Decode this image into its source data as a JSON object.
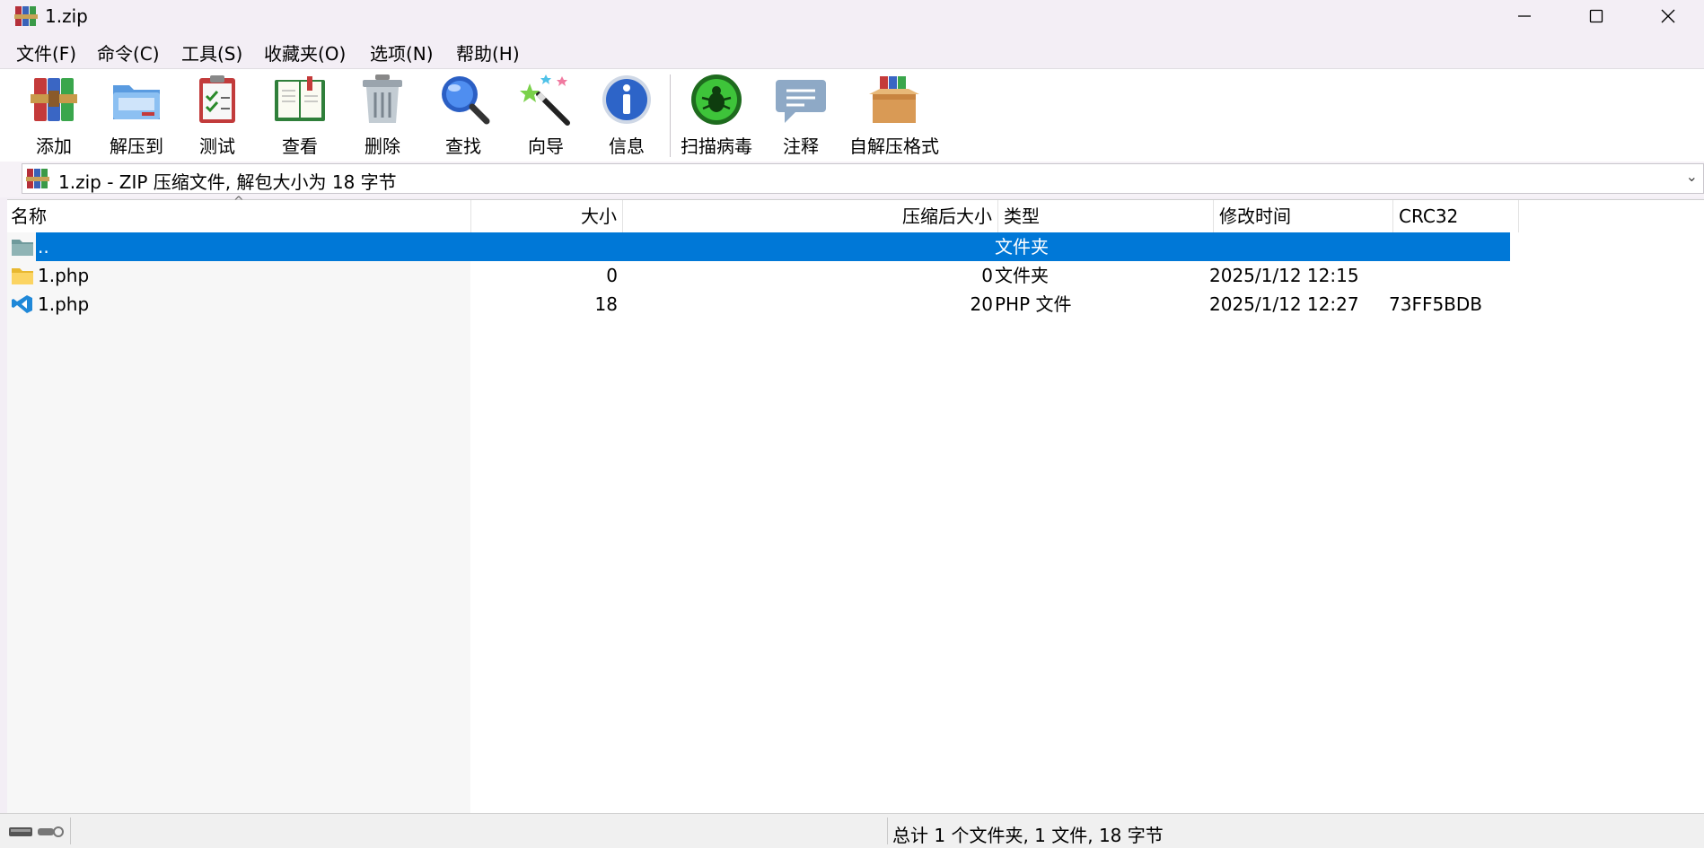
{
  "window": {
    "title": "1.zip",
    "controls": [
      "minimize",
      "maximize",
      "close"
    ]
  },
  "menu": [
    "文件(F)",
    "命令(C)",
    "工具(S)",
    "收藏夹(O)",
    "选项(N)",
    "帮助(H)"
  ],
  "toolbar": {
    "buttons": [
      {
        "label": "添加",
        "icon": "add-archive-icon"
      },
      {
        "label": "解压到",
        "icon": "extract-folder-icon"
      },
      {
        "label": "测试",
        "icon": "test-clipboard-icon"
      },
      {
        "label": "查看",
        "icon": "view-book-icon"
      },
      {
        "label": "删除",
        "icon": "trash-icon"
      },
      {
        "label": "查找",
        "icon": "magnifier-icon"
      },
      {
        "label": "向导",
        "icon": "wizard-wand-icon"
      },
      {
        "label": "信息",
        "icon": "info-icon"
      },
      {
        "label": "扫描病毒",
        "icon": "virus-scan-icon"
      },
      {
        "label": "注释",
        "icon": "comment-icon"
      },
      {
        "label": "自解压格式",
        "icon": "sfx-box-icon"
      }
    ]
  },
  "address": {
    "text": "1.zip - ZIP 压缩文件, 解包大小为 18 字节"
  },
  "columns": [
    "名称",
    "大小",
    "压缩后大小",
    "类型",
    "修改时间",
    "CRC32"
  ],
  "files": [
    {
      "name": "..",
      "size": "",
      "packed": "",
      "type": "文件夹",
      "modified": "",
      "crc": "",
      "icon": "parent-folder-icon",
      "selected": true
    },
    {
      "name": "1.php",
      "size": "0",
      "packed": "0",
      "type": "文件夹",
      "modified": "2025/1/12 12:15",
      "crc": "",
      "icon": "folder-icon",
      "selected": false
    },
    {
      "name": "1.php",
      "size": "18",
      "packed": "20",
      "type": "PHP 文件",
      "modified": "2025/1/12 12:27",
      "crc": "73FF5BDB",
      "icon": "vscode-file-icon",
      "selected": false
    }
  ],
  "status": {
    "summary": "总计 1 个文件夹, 1 文件, 18 字节"
  },
  "colors": {
    "selection": "#0078d7",
    "titlebar": "#f3eef5"
  }
}
